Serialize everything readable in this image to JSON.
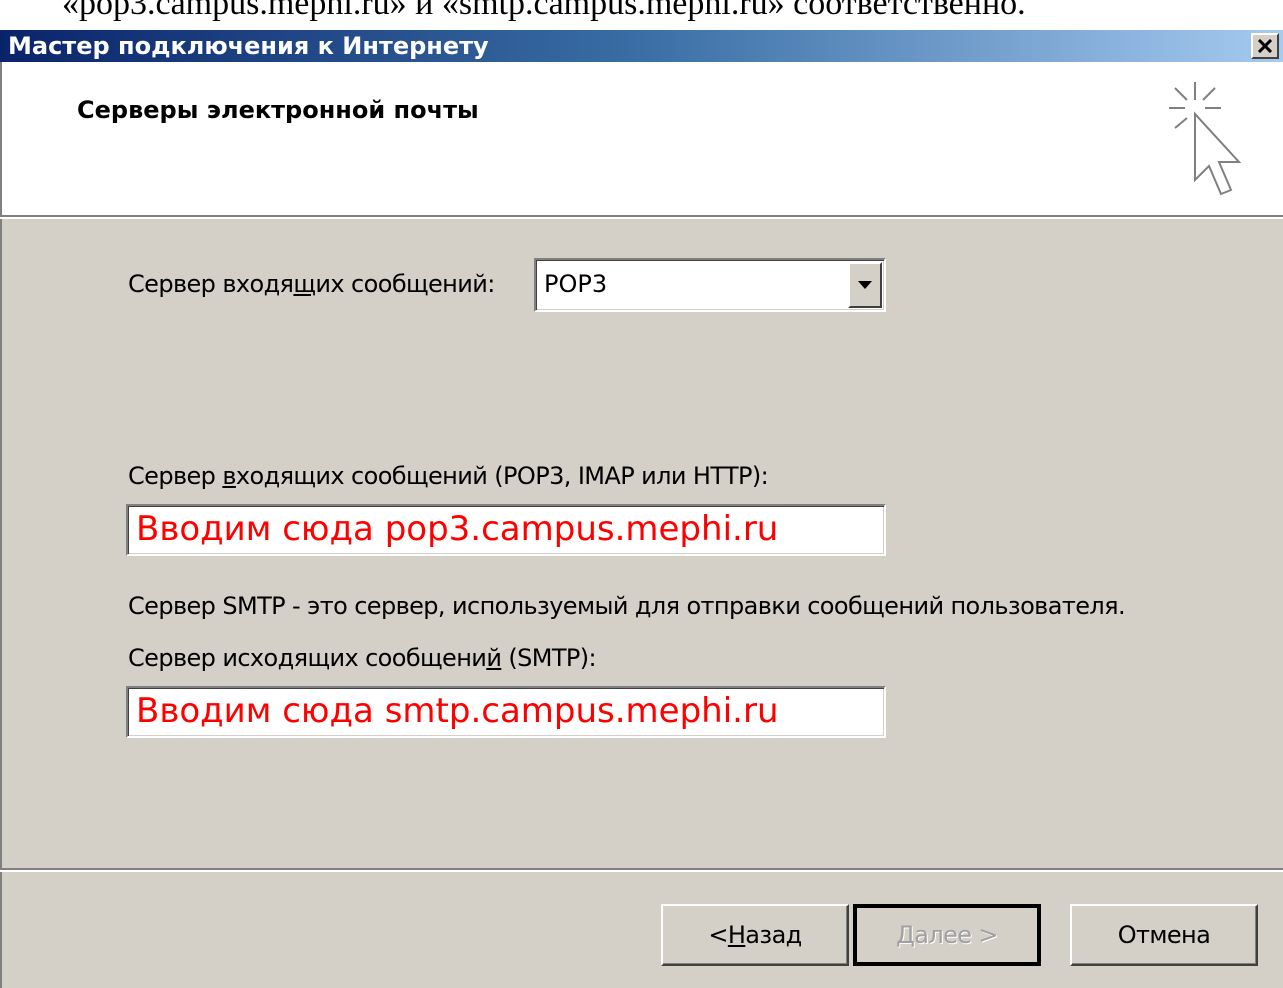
{
  "page_top_text": "«pop3.campus.mephi.ru» и «smtp.campus.mephi.ru» соответственно.",
  "window": {
    "title": "Мастер подключения к Интернету",
    "close_label": "×"
  },
  "header": {
    "title": "Серверы электронной почты",
    "icon": "wizard-cursor-icon"
  },
  "incoming_type": {
    "label_before": "Сервер входя",
    "label_underline": "щ",
    "label_after": "их сообщений:",
    "selected": "POP3"
  },
  "incoming_server": {
    "label_before": "Сервер ",
    "label_underline": "в",
    "label_after": "ходящих сообщений (POP3, IMAP или HTTP):",
    "value": "Вводим сюда pop3.campus.mephi.ru"
  },
  "smtp_note": "Сервер SMTP - это сервер, используемый для отправки сообщений  пользователя.",
  "outgoing_server": {
    "label_before": "Сервер исходящих сообщени",
    "label_underline": "й",
    "label_after": " (SMTP):",
    "value": "Вводим сюда smtp.campus.mephi.ru"
  },
  "buttons": {
    "back_prefix": "< ",
    "back_underline": "Н",
    "back_rest": "азад",
    "next_underline": "Д",
    "next_rest": "алее >",
    "cancel": "Отмена"
  },
  "colors": {
    "title_bar_start": "#0a246a",
    "title_bar_end": "#a6caf0",
    "dialog_face": "#d4d0c8",
    "field_text": "#ff0000"
  }
}
